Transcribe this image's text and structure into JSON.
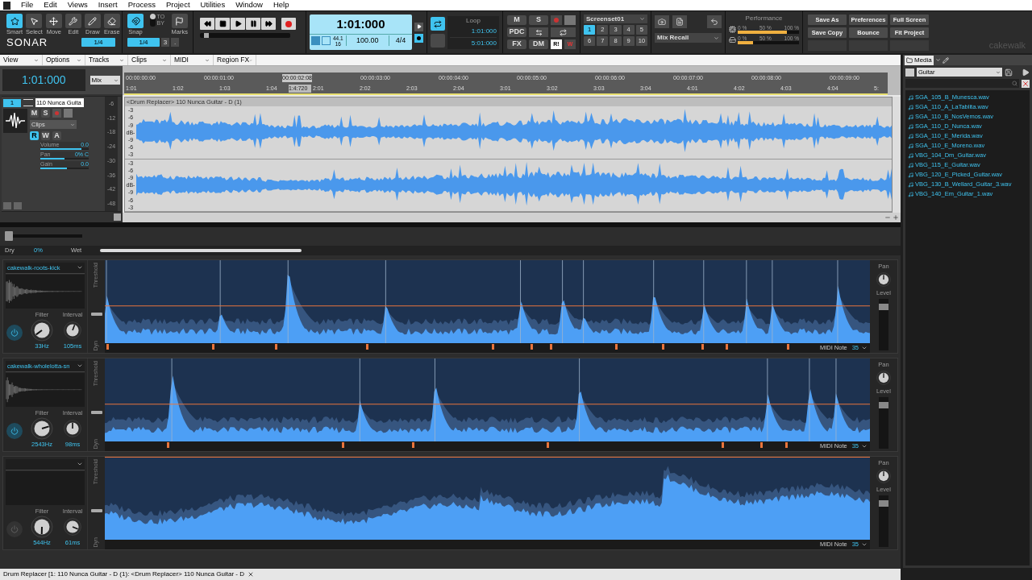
{
  "menu": [
    "File",
    "Edit",
    "Views",
    "Insert",
    "Process",
    "Project",
    "Utilities",
    "Window",
    "Help"
  ],
  "tools": [
    {
      "label": "Smart",
      "selected": true
    },
    {
      "label": "Select",
      "selected": false
    },
    {
      "label": "Move",
      "selected": false
    },
    {
      "label": "Edit",
      "selected": false
    },
    {
      "label": "Draw",
      "selected": false
    },
    {
      "label": "Erase",
      "selected": false
    }
  ],
  "logo": "SONAR",
  "tool_resolution": "1/4",
  "snap": {
    "label": "Snap",
    "on": true,
    "to": "TO",
    "by": "BY",
    "toggle": {
      "on": false
    },
    "resolution": "1/4",
    "triplet": "3",
    "dot": ".",
    "marks": "Marks"
  },
  "transport": {
    "level": 0.05,
    "time": "1:01:000",
    "sample_rate": "44.1",
    "bit_depth": "16",
    "tempo": "100.00",
    "meter": "4/4"
  },
  "loop": {
    "label": "Loop",
    "on": true,
    "start": "1:01:000",
    "end": "5:01:000"
  },
  "mix": {
    "mute": "M",
    "solo": "S",
    "pdc": "PDC",
    "fx": "FX",
    "dm": "DM",
    "read": "R!",
    "write": "W"
  },
  "screenset": {
    "name": "Screenset01",
    "slots": [
      {
        "label": "1",
        "selected": true
      },
      {
        "label": "2",
        "selected": false
      },
      {
        "label": "3",
        "selected": false
      },
      {
        "label": "4",
        "selected": false
      },
      {
        "label": "5",
        "selected": false
      },
      {
        "label": "6",
        "selected": false
      },
      {
        "label": "7",
        "selected": false
      },
      {
        "label": "8",
        "selected": false
      },
      {
        "label": "9",
        "selected": false
      },
      {
        "label": "10",
        "selected": false
      }
    ]
  },
  "mix_recall": "Mix Recall",
  "performance": {
    "label": "Performance",
    "meters": [
      {
        "level": 0.8,
        "scale": [
          "0 %",
          "50 %",
          "100 %"
        ]
      },
      {
        "level": 0.25,
        "scale": [
          "0 %",
          "50 %",
          "100 %"
        ]
      }
    ]
  },
  "actions": [
    "Save As",
    "Preferences",
    "Full Screen",
    "Save Copy",
    "Bounce",
    "Fit Project"
  ],
  "brand": "cakewalk",
  "track_view": {
    "menus": [
      "View",
      "Options",
      "Tracks",
      "Clips",
      "MIDI",
      "Region FX"
    ],
    "now": "1:01:000",
    "mode": "Mix",
    "ruler": {
      "times": [
        "00:00:00:00",
        "00:00:01:00",
        "00:00:02:08",
        "00:00:03:00",
        "00:00:04:00",
        "00:00:05:00",
        "00:00:06:00",
        "00:00:07:00",
        "00:00:08:00",
        "00:00:09:00"
      ],
      "measures": [
        "1:01",
        "1:02",
        "1:03",
        "1:04",
        "1:4:720",
        "2:01",
        "2:02",
        "2:03",
        "2:04",
        "3:01",
        "3:02",
        "3:03",
        "3:04",
        "4:01",
        "4:02",
        "4:03",
        "4:04",
        "5:"
      ]
    },
    "track": {
      "number": "1",
      "name": "110 Nunca Guita",
      "mode": "Clips",
      "buttons": [
        {
          "label": "M",
          "on": false
        },
        {
          "label": "S",
          "on": false
        }
      ],
      "auto": [
        {
          "label": "R",
          "on": true
        },
        {
          "label": "W",
          "on": false
        },
        {
          "label": "A",
          "on": false
        }
      ],
      "params": [
        {
          "label": "Volume",
          "value": "0.0",
          "level": 0.85
        },
        {
          "label": "Pan",
          "value": "0% C",
          "level": 0.5
        },
        {
          "label": "Gain",
          "value": "0.0",
          "level": 0.55
        }
      ],
      "meter_scale": [
        "-6",
        "-12",
        "-18",
        "-24",
        "-30",
        "-36",
        "-42",
        "-48"
      ]
    },
    "clip": {
      "title": "<Drum Replacer> 110 Nunca Guitar - D (1)",
      "scales": [
        [
          "-3",
          "-6",
          "-9",
          "dB-",
          "-9",
          "-6",
          "-3"
        ],
        [
          "-3",
          "-6",
          "-9",
          "dB-",
          "-9",
          "-6",
          "-3"
        ]
      ]
    }
  },
  "drum_replacer": {
    "dry_wet": {
      "dry": "Dry",
      "value": "0%",
      "wet": "Wet",
      "level": 0
    },
    "lanes": [
      {
        "sample": "cakewalk-roots-kick",
        "enabled": true,
        "filter": "33Hz",
        "interval": "105ms",
        "midi_note": "35",
        "labels": {
          "filter": "Filter",
          "interval": "Interval",
          "threshold": "Threshold",
          "dyn": "Dyn",
          "midi": "MIDI Note",
          "pan": "Pan",
          "level": "Level"
        }
      },
      {
        "sample": "cakewalk-wholelotta-sn",
        "enabled": true,
        "filter": "2543Hz",
        "interval": "98ms",
        "midi_note": "35",
        "labels": {
          "filter": "Filter",
          "interval": "Interval",
          "threshold": "Threshold",
          "dyn": "Dyn",
          "midi": "MIDI Note",
          "pan": "Pan",
          "level": "Level"
        }
      },
      {
        "enabled": false,
        "filter": "544Hz",
        "interval": "61ms",
        "midi_note": "35",
        "labels": {
          "filter": "Filter",
          "interval": "Interval",
          "threshold": "Threshold",
          "dyn": "Dyn",
          "midi": "MIDI Note",
          "pan": "Pan",
          "level": "Level"
        }
      }
    ]
  },
  "browser": {
    "tabs": [
      {
        "label": "Media",
        "selected": true
      }
    ],
    "folder": "Guitar",
    "files": [
      "SGA_105_B_Munesca.wav",
      "SGA_110_A_LaTablita.wav",
      "SGA_110_B_NosVemos.wav",
      "SGA_110_D_Nunca.wav",
      "SGA_110_E_Merida.wav",
      "SGA_110_E_Moreno.wav",
      "VBG_104_Dm_Guitar.wav",
      "VBG_115_E_Guitar.wav",
      "VBG_120_E_Picked_Guitar.wav",
      "VBG_130_B_Wellard_Guitar_3.wav",
      "VBG_140_Em_Guitar_1.wav"
    ]
  },
  "status_tab": {
    "label": "Drum Replacer [1: 110 Nunca Guitar - D (1): <Drum Replacer> 110 Nunca Guitar - D"
  }
}
